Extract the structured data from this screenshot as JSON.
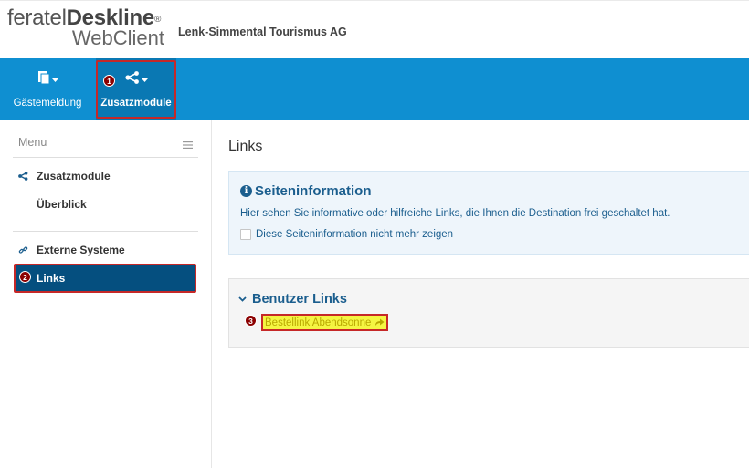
{
  "header": {
    "logo_feratel": "feratel",
    "logo_deskline": "Deskline",
    "logo_reg": "®",
    "logo_webclient": "WebClient",
    "company": "Lenk-Simmental Tourismus AG"
  },
  "toolbar": {
    "items": [
      {
        "label": "Gästemeldung",
        "icon": "document-icon"
      },
      {
        "label": "Zusatzmodule",
        "icon": "share-icon"
      }
    ],
    "badge": "1"
  },
  "sidebar": {
    "menu_label": "Menu",
    "sections": [
      {
        "label": "Zusatzmodule",
        "icon": "share-icon",
        "items": [
          "Überblick"
        ]
      },
      {
        "label": "Externe Systeme",
        "icon": "link-icon",
        "items": [
          "Links"
        ]
      }
    ],
    "active_badge": "2"
  },
  "main": {
    "title": "Links",
    "info": {
      "title": "Seiteninformation",
      "text": "Hier sehen Sie informative oder hilfreiche Links, die Ihnen die Destination frei geschaltet hat.",
      "checkbox_label": "Diese Seiteninformation nicht mehr zeigen"
    },
    "user_links": {
      "title": "Benutzer Links",
      "badge": "3",
      "link": "Bestellink Abendsonne"
    }
  },
  "colors": {
    "toolbar_blue": "#0f8fd1",
    "active_blue": "#054f7f",
    "highlight_red": "#c62828",
    "link_highlight": "#f5f542"
  }
}
